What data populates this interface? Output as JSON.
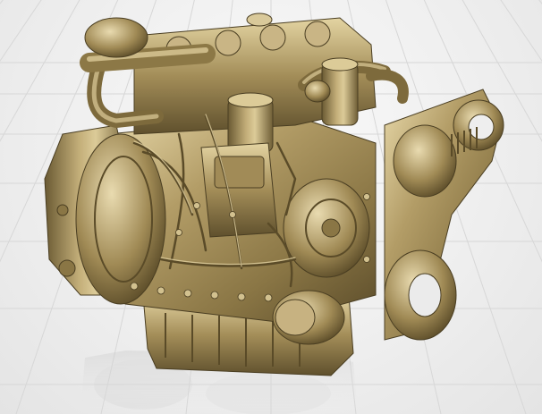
{
  "viewport": {
    "background_color": "#f2f2f2",
    "grid_color": "#d7d7d7",
    "grid_visible": true
  },
  "model": {
    "subject": "engine-model",
    "material_color": "#a8925f",
    "highlight_color": "#e6d6a6",
    "shadow_color": "#4a3e22"
  },
  "reflection": {
    "visible": true
  }
}
